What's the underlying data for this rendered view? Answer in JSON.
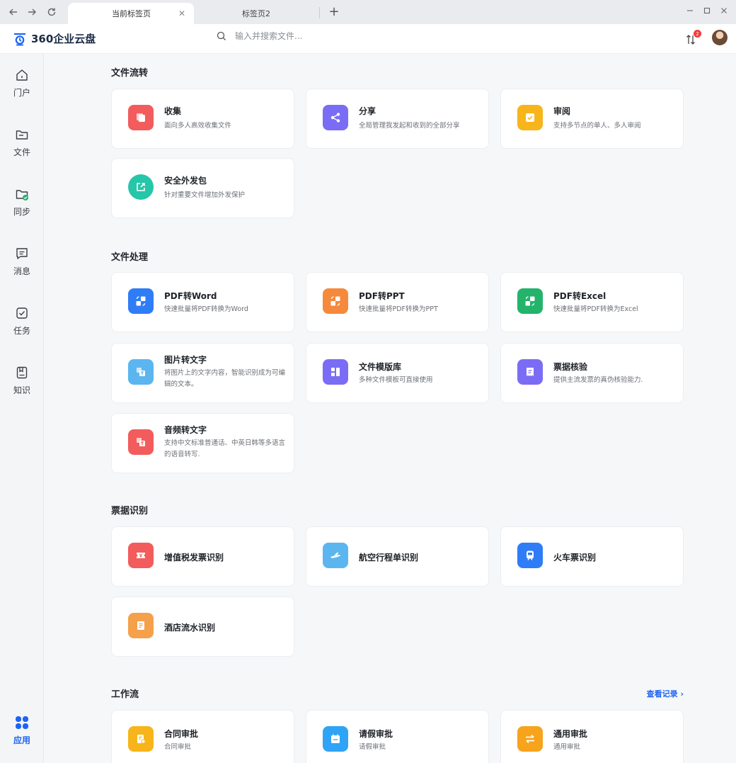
{
  "browser": {
    "tabs": [
      {
        "label": "当前标签页",
        "active": true
      },
      {
        "label": "标签页2",
        "active": false
      }
    ]
  },
  "header": {
    "app_name": "360企业云盘",
    "search_placeholder": "输入并搜索文件...",
    "transfer_badge": "2"
  },
  "sidebar": {
    "items": [
      {
        "label": "门户",
        "icon": "home-icon"
      },
      {
        "label": "文件",
        "icon": "folder-icon"
      },
      {
        "label": "同步",
        "icon": "sync-folder-icon"
      },
      {
        "label": "消息",
        "icon": "message-icon"
      },
      {
        "label": "任务",
        "icon": "task-icon"
      },
      {
        "label": "知识",
        "icon": "knowledge-icon"
      },
      {
        "label": "应用",
        "icon": "apps-icon",
        "active": true
      }
    ]
  },
  "sections": {
    "file_flow": {
      "title": "文件流转",
      "cards": [
        {
          "title": "收集",
          "desc": "面向多人高效收集文件",
          "color": "#f25c5c"
        },
        {
          "title": "分享",
          "desc": "全局管理我发起和收到的全部分享",
          "color": "#7b6cf6"
        },
        {
          "title": "审阅",
          "desc": "支持多节点的单人、多人审阅",
          "color": "#f7b51b"
        },
        {
          "title": "安全外发包",
          "desc": "针对重要文件增加外发保护",
          "color": "#26c6a8"
        }
      ]
    },
    "file_process": {
      "title": "文件处理",
      "cards": [
        {
          "title": "PDF转Word",
          "desc": "快速批量将PDF转换为Word",
          "color": "#2f7df6"
        },
        {
          "title": "PDF转PPT",
          "desc": "快速批量将PDF转换为PPT",
          "color": "#f58a3c"
        },
        {
          "title": "PDF转Excel",
          "desc": "快速批量将PDF转换为Excel",
          "color": "#24b36b"
        },
        {
          "title": "图片转文字",
          "desc": "将图片上的文字内容，智能识别成为可编辑的文本。",
          "color": "#5bb6f0"
        },
        {
          "title": "文件模版库",
          "desc": "多种文件模板可直接使用",
          "color": "#7b6cf6"
        },
        {
          "title": "票据核验",
          "desc": "提供主流发票的真伪核验能力.",
          "color": "#7b6cf6"
        },
        {
          "title": "音频转文字",
          "desc": "支持中文标准普通话、中英日韩等多语言的语音转写.",
          "color": "#f25c5c"
        }
      ]
    },
    "receipt": {
      "title": "票据识别",
      "cards": [
        {
          "title": "增值税发票识别",
          "color": "#f25c5c"
        },
        {
          "title": "航空行程单识别",
          "color": "#5bb6f0"
        },
        {
          "title": "火车票识别",
          "color": "#2f7df6"
        },
        {
          "title": "酒店流水识别",
          "color": "#f5a04a"
        }
      ]
    },
    "workflow": {
      "title": "工作流",
      "view_log": "查看记录",
      "cards": [
        {
          "title": "合同审批",
          "desc": "合同审批",
          "color": "#f7b51b"
        },
        {
          "title": "请假审批",
          "desc": "请假审批",
          "color": "#2fa4f6"
        },
        {
          "title": "通用审批",
          "desc": "通用审批",
          "color": "#f7a31b"
        }
      ]
    }
  }
}
